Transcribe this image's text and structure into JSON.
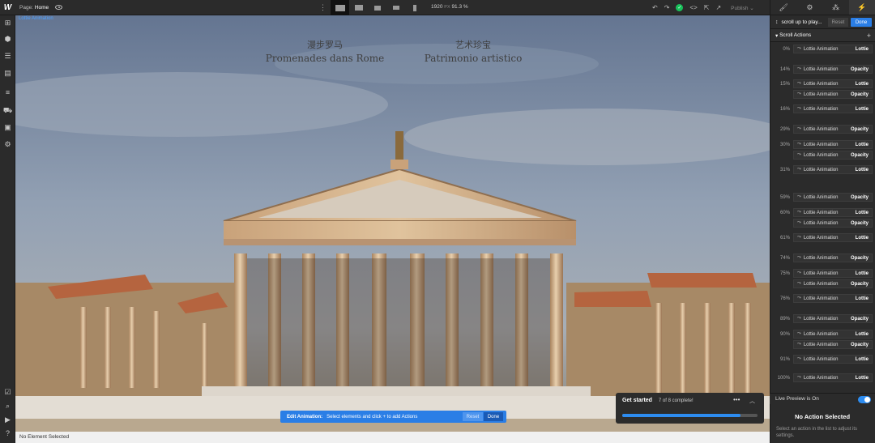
{
  "topbar": {
    "logo": "W",
    "page_label": "Page:",
    "page_name": "Home",
    "canvas_width": "1920",
    "canvas_unit": "PX",
    "zoom": "91.3 %",
    "publish_label": "Publish"
  },
  "canvas": {
    "element_tag": "Lottie Animation",
    "title_left_cn": "漫步罗马",
    "title_left_fr": "Promenades dans Rome",
    "title_right_cn": "艺术珍宝",
    "title_right_it": "Patrimonio artistico"
  },
  "statusbar": {
    "text": "No Element Selected"
  },
  "edit_animation": {
    "label": "Edit Animation:",
    "hint": "Select elements and click + to add Actions",
    "reset": "Reset",
    "done": "Done"
  },
  "get_started": {
    "title": "Get started",
    "count": "7 of 8 complete!",
    "progress": 0.875
  },
  "right_panel": {
    "trigger_label": "scroll up to play...",
    "reset": "Reset",
    "done": "Done",
    "scroll_actions_title": "Scroll Actions",
    "steps": [
      {
        "pct": "0%",
        "actions": [
          {
            "name": "Lottie Animation",
            "type": "Lottie"
          }
        ]
      },
      {
        "pct": "14%",
        "actions": [
          {
            "name": "Lottie Animation",
            "type": "Opacity"
          }
        ]
      },
      {
        "pct": "15%",
        "actions": [
          {
            "name": "Lottie Animation",
            "type": "Lottie"
          },
          {
            "name": "Lottie Animation",
            "type": "Opacity"
          }
        ]
      },
      {
        "pct": "16%",
        "actions": [
          {
            "name": "Lottie Animation",
            "type": "Lottie"
          }
        ]
      },
      {
        "pct": "29%",
        "actions": [
          {
            "name": "Lottie Animation",
            "type": "Opacity"
          }
        ]
      },
      {
        "pct": "30%",
        "actions": [
          {
            "name": "Lottie Animation",
            "type": "Lottie"
          },
          {
            "name": "Lottie Animation",
            "type": "Opacity"
          }
        ]
      },
      {
        "pct": "31%",
        "actions": [
          {
            "name": "Lottie Animation",
            "type": "Lottie"
          }
        ]
      },
      {
        "pct": "59%",
        "actions": [
          {
            "name": "Lottie Animation",
            "type": "Opacity"
          }
        ]
      },
      {
        "pct": "60%",
        "actions": [
          {
            "name": "Lottie Animation",
            "type": "Lottie"
          },
          {
            "name": "Lottie Animation",
            "type": "Opacity"
          }
        ]
      },
      {
        "pct": "61%",
        "actions": [
          {
            "name": "Lottie Animation",
            "type": "Lottie"
          }
        ]
      },
      {
        "pct": "74%",
        "actions": [
          {
            "name": "Lottie Animation",
            "type": "Opacity"
          }
        ]
      },
      {
        "pct": "75%",
        "actions": [
          {
            "name": "Lottie Animation",
            "type": "Lottie"
          },
          {
            "name": "Lottie Animation",
            "type": "Opacity"
          }
        ]
      },
      {
        "pct": "76%",
        "actions": [
          {
            "name": "Lottie Animation",
            "type": "Lottie"
          }
        ]
      },
      {
        "pct": "89%",
        "actions": [
          {
            "name": "Lottie Animation",
            "type": "Opacity"
          }
        ]
      },
      {
        "pct": "90%",
        "actions": [
          {
            "name": "Lottie Animation",
            "type": "Lottie"
          },
          {
            "name": "Lottie Animation",
            "type": "Opacity"
          }
        ]
      },
      {
        "pct": "91%",
        "actions": [
          {
            "name": "Lottie Animation",
            "type": "Lottie"
          }
        ]
      },
      {
        "pct": "100%",
        "actions": [
          {
            "name": "Lottie Animation",
            "type": "Lottie"
          }
        ]
      }
    ],
    "live_preview_label": "Live Preview is On",
    "no_action_title": "No Action Selected",
    "no_action_desc": "Select an action in the list to adjust its settings."
  },
  "colors": {
    "accent": "#2a7ee6",
    "success": "#18c15a",
    "panel": "#2b2b2b"
  }
}
